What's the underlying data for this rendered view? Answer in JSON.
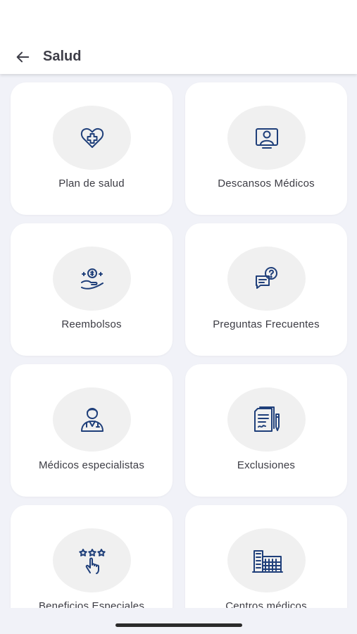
{
  "header": {
    "title": "Salud",
    "back_icon": "arrow-left-icon"
  },
  "colors": {
    "icon_blue": "#1f3f7a",
    "background": "#f1f2f8",
    "card": "#ffffff",
    "icon_circle": "#f0f0f0"
  },
  "cards": [
    {
      "label": "Plan de salud",
      "icon": "heart-plus-icon"
    },
    {
      "label": "Descansos Médicos",
      "icon": "doctor-monitor-icon"
    },
    {
      "label": "Reembolsos",
      "icon": "hand-money-icon"
    },
    {
      "label": "Preguntas Frecuentes",
      "icon": "question-chat-icon"
    },
    {
      "label": "Médicos especialistas",
      "icon": "doctor-icon"
    },
    {
      "label": "Exclusiones",
      "icon": "document-pen-icon"
    },
    {
      "label": "Beneficios Especiales",
      "icon": "hand-stars-icon"
    },
    {
      "label": "Centros médicos",
      "icon": "hospital-building-icon"
    }
  ]
}
